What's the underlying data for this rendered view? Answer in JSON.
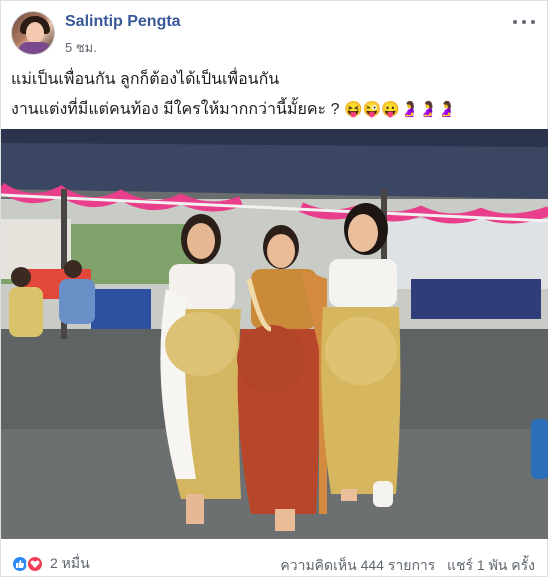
{
  "post": {
    "author": "Salintip Pengta",
    "timestamp": "5 ชม.",
    "text_line1": "แม่เป็นเพื่อนกัน ลูกก็ต้องได้เป็นเพื่อนกัน",
    "text_line2": "งานแต่งที่มีแต่คนท้อง มีใครให้มากกว่านี้มั้ยคะ ?",
    "emojis": "😝😜😛🤰🤰🤰"
  },
  "footer": {
    "reaction_icons": [
      "like-icon",
      "love-icon"
    ],
    "reaction_count": "2 หมื่น",
    "comments": "ความคิดเห็น 444 รายการ",
    "shares": "แชร์ 1 พัน ครั้ง"
  },
  "colors": {
    "author": "#385898",
    "like": "#2e89ff",
    "love": "#f33e58",
    "tent": "#3b4663",
    "bunting": "#e83e8c"
  }
}
